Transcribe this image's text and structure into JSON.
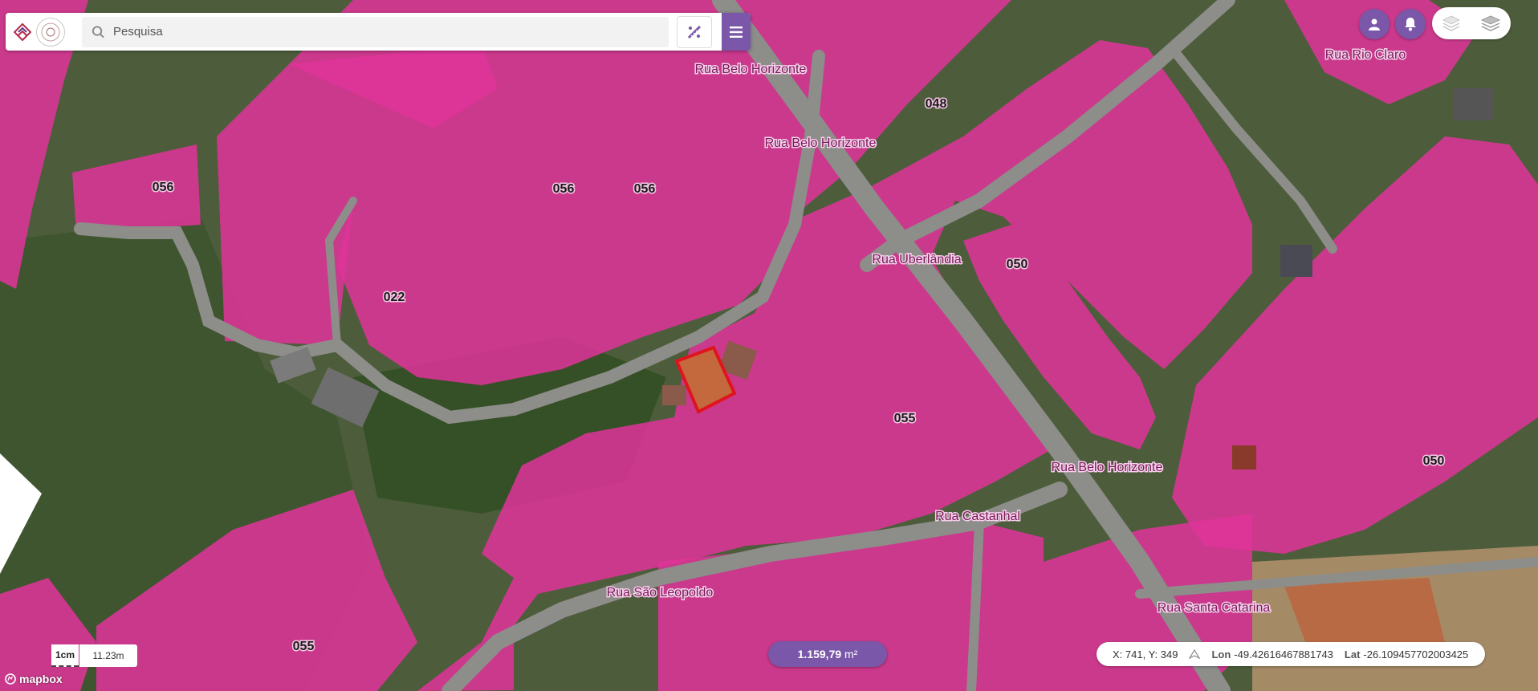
{
  "search": {
    "placeholder": "Pesquisa"
  },
  "map": {
    "block_labels": [
      "056",
      "056",
      "056",
      "022",
      "048",
      "050",
      "050",
      "055",
      "055"
    ],
    "street_labels": [
      "Rua Belo Horizonte",
      "Rua Belo Horizonte",
      "Rua Uberlândia",
      "Rua Belo Horizonte",
      "Rua Castanhal",
      "Rua São Leopoldo",
      "Rua Santa Catarina",
      "Rua Rio Claro"
    ]
  },
  "scale": {
    "unit": "1cm",
    "value": "11.23m"
  },
  "area": {
    "value": "1.159,79",
    "unit": "m²"
  },
  "coords": {
    "xy": "X: 741, Y: 349",
    "lon_label": "Lon",
    "lon": "-49.42616467881743",
    "lat_label": "Lat",
    "lat": "-26.109457702003425"
  },
  "attribution": "mapbox",
  "colors": {
    "accent": "#7a57a8",
    "parcel_fill": "#e0339a",
    "selection": "#e0141c"
  },
  "icons": [
    "search-icon",
    "measure-icon",
    "menu-icon",
    "user-icon",
    "bell-icon",
    "layers-light-icon",
    "layers-icon",
    "compass-icon",
    "mapbox-logo-icon"
  ]
}
